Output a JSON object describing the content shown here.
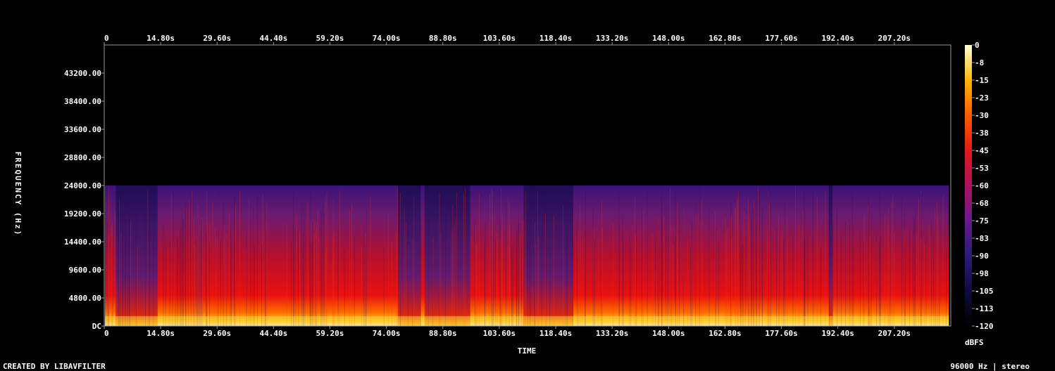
{
  "chart_data": {
    "type": "heatmap",
    "title": "",
    "xlabel": "TIME",
    "ylabel": "FREQUENCY (Hz)",
    "x_ticks": [
      "0",
      "14.80s",
      "29.60s",
      "44.40s",
      "59.20s",
      "74.00s",
      "88.80s",
      "103.60s",
      "118.40s",
      "133.20s",
      "148.00s",
      "162.80s",
      "177.60s",
      "192.40s",
      "207.20s"
    ],
    "x_tick_values": [
      0,
      14.8,
      29.6,
      44.4,
      59.2,
      74.0,
      88.8,
      103.6,
      118.4,
      133.2,
      148.0,
      162.8,
      177.6,
      192.4,
      207.2
    ],
    "xlim": [
      0,
      222
    ],
    "y_ticks": [
      "DC",
      "4800.00",
      "9600.00",
      "14400.00",
      "19200.00",
      "24000.00",
      "28800.00",
      "33600.00",
      "38400.00",
      "43200.00"
    ],
    "y_tick_values": [
      0,
      4800,
      9600,
      14400,
      19200,
      24000,
      28800,
      33600,
      38400,
      43200
    ],
    "ylim": [
      0,
      48000
    ],
    "colorbar": {
      "label": "dBFS",
      "ticks": [
        "0",
        "-8",
        "-15",
        "-23",
        "-30",
        "-38",
        "-45",
        "-53",
        "-60",
        "-68",
        "-75",
        "-83",
        "-90",
        "-98",
        "-105",
        "-113",
        "-120"
      ],
      "range": [
        -120,
        0
      ]
    },
    "content_cutoff_hz": 24000,
    "quiet_segments_s": [
      [
        3,
        14
      ],
      [
        77,
        83
      ],
      [
        84,
        96
      ],
      [
        110,
        123
      ],
      [
        190,
        191
      ]
    ],
    "audio_end_s": 221.5,
    "colors": {
      "background": "#000000",
      "low": "#1a0a52",
      "mid": "#d01010",
      "high": "#ffffb0"
    }
  },
  "footer": {
    "created_by": "CREATED BY LIBAVFILTER",
    "format": "96000 Hz | stereo"
  }
}
